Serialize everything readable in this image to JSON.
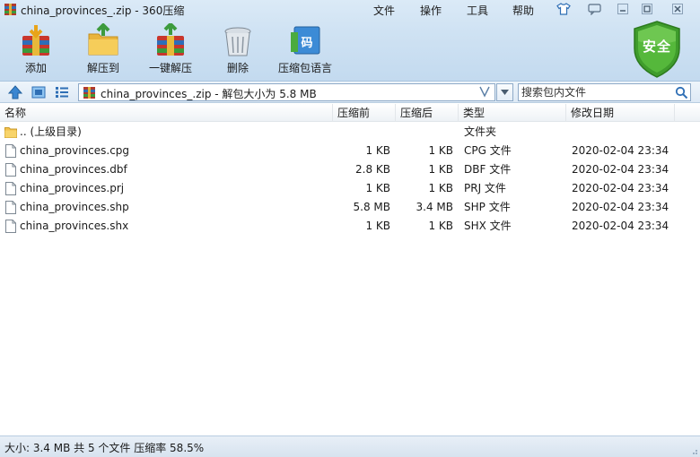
{
  "window": {
    "title": "china_provinces_.zip - 360压缩",
    "menus": [
      "文件",
      "操作",
      "工具",
      "帮助"
    ]
  },
  "toolbar": {
    "add_label": "添加",
    "extract_to_label": "解压到",
    "one_click_label": "一键解压",
    "delete_label": "删除",
    "lang_pack_label": "压缩包语言"
  },
  "security_badge": {
    "label": "安全",
    "color": "#4caf36"
  },
  "address": {
    "text": "china_provinces_.zip - 解包大小为 5.8 MB"
  },
  "search": {
    "placeholder": "搜索包内文件"
  },
  "columns": {
    "name": "名称",
    "before": "压缩前",
    "after": "压缩后",
    "type": "类型",
    "date": "修改日期"
  },
  "files": [
    {
      "name": ".. (上级目录)",
      "before": "",
      "after": "",
      "type": "文件夹",
      "date": "",
      "icon": "folder-icon"
    },
    {
      "name": "china_provinces.cpg",
      "before": "1 KB",
      "after": "1 KB",
      "type": "CPG 文件",
      "date": "2020-02-04 23:34",
      "icon": "file-icon"
    },
    {
      "name": "china_provinces.dbf",
      "before": "2.8 KB",
      "after": "1 KB",
      "type": "DBF 文件",
      "date": "2020-02-04 23:34",
      "icon": "file-icon"
    },
    {
      "name": "china_provinces.prj",
      "before": "1 KB",
      "after": "1 KB",
      "type": "PRJ 文件",
      "date": "2020-02-04 23:34",
      "icon": "file-icon"
    },
    {
      "name": "china_provinces.shp",
      "before": "5.8 MB",
      "after": "3.4 MB",
      "type": "SHP 文件",
      "date": "2020-02-04 23:34",
      "icon": "file-icon"
    },
    {
      "name": "china_provinces.shx",
      "before": "1 KB",
      "after": "1 KB",
      "type": "SHX 文件",
      "date": "2020-02-04 23:34",
      "icon": "file-icon"
    }
  ],
  "status": {
    "text": "大小: 3.4 MB 共 5 个文件 压缩率 58.5%"
  },
  "colors": {
    "chrome": "#cfe2f3",
    "accent": "#3f7fc1",
    "shield": "#4caf36"
  }
}
